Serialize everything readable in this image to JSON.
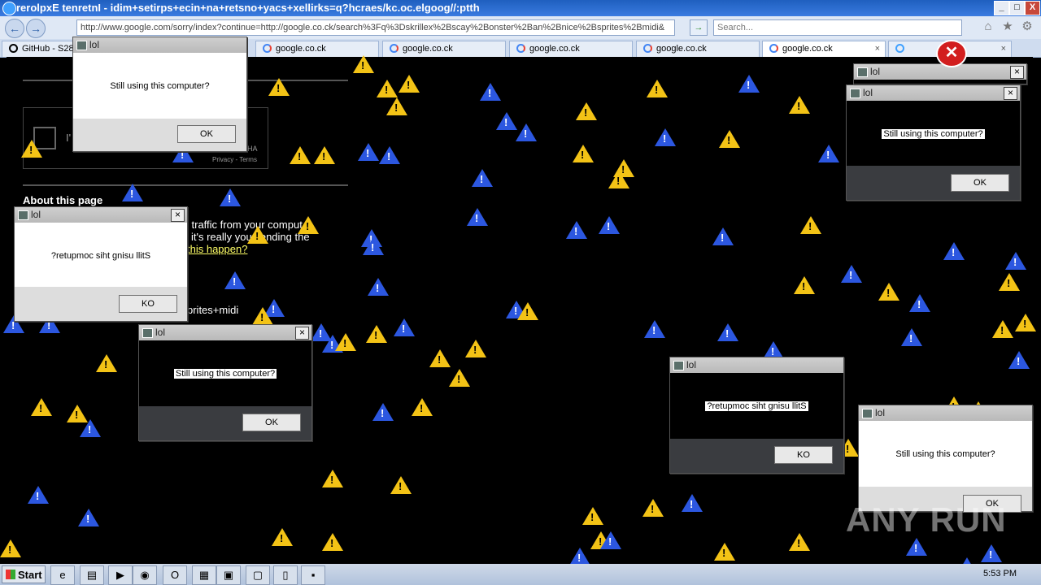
{
  "window": {
    "title": "rerolpxE tenretnI - idim+setirps+ecin+na+retsno+yacs+xellirks=q?hcraes/kc.oc.elgoog//:ptth",
    "min": "_",
    "max": "□",
    "close": "X"
  },
  "toolbar": {
    "back": "←",
    "forward": "→",
    "url": "http://www.google.com/sorry/index?continue=http://google.co.ck/search%3Fq%3Dskrillex%2Bscay%2Bonster%2Ban%2Bnice%2Bsprites%2Bmidi&",
    "go": "→",
    "search_placeholder": "Search...",
    "home": "⌂",
    "fav": "★",
    "tools": "⚙"
  },
  "tabs": [
    {
      "label": "GitHub - S28"
    },
    {
      "label": "google.co.ck"
    },
    {
      "label": "google.co.ck"
    },
    {
      "label": "google.co.ck"
    },
    {
      "label": "google.co.ck"
    },
    {
      "label": "google.co.ck"
    }
  ],
  "page": {
    "about": "About this page",
    "line1": "l traffic from your comput",
    "line2": "it's really you sending the",
    "link": "this happen?",
    "sprites": "prites+midi",
    "privacy": "Privacy - Terms",
    "robot_label": "I'",
    "ha": "HA"
  },
  "dialogs": [
    {
      "title": "lol",
      "message": "Still using this computer?",
      "button": "OK"
    },
    {
      "title": "lol",
      "message": "?retupmoc siht gnisu llitS",
      "button": "KO"
    },
    {
      "title": "lol",
      "message": "Still using this computer?",
      "button": "OK"
    },
    {
      "title": "lol",
      "message": "Still using this computer?",
      "button": "OK"
    },
    {
      "title": "lol",
      "message": "?retupmoc siht gnisu llitS",
      "button": "KO"
    },
    {
      "title": "lol",
      "message": "Still using this computer?",
      "button": "OK"
    },
    {
      "title": "lol",
      "message": "",
      "button": ""
    }
  ],
  "taskbar": {
    "start": "Start",
    "clock": "5:53 PM"
  },
  "watermark": "ANY RUN",
  "colors": {
    "warning_yellow": "#f3c316",
    "warning_blue": "#2c57e0",
    "titlebar": "#1f5fbf"
  }
}
